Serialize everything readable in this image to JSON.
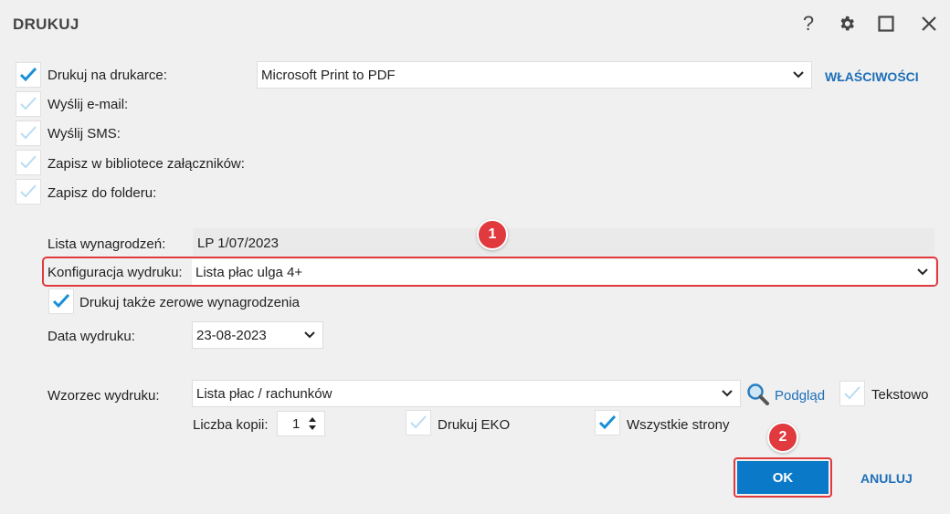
{
  "window": {
    "title": "DRUKUJ"
  },
  "options": {
    "print_printer": {
      "label": "Drukuj na drukarce:",
      "checked": true
    },
    "send_email": {
      "label": "Wyślij e-mail:",
      "checked": false
    },
    "send_sms": {
      "label": "Wyślij SMS:",
      "checked": false
    },
    "save_attachments": {
      "label": "Zapisz w bibliotece załączników:",
      "checked": false
    },
    "save_folder": {
      "label": "Zapisz do folderu:",
      "checked": false
    }
  },
  "printer": {
    "value": "Microsoft Print to PDF",
    "properties_label": "WŁAŚCIWOŚCI"
  },
  "payroll": {
    "label": "Lista wynagrodzeń:",
    "value": "LP 1/07/2023"
  },
  "config": {
    "label": "Konfiguracja wydruku:",
    "value": "Lista płac ulga 4+"
  },
  "zero_wages": {
    "label": "Drukuj także zerowe wynagrodzenia",
    "checked": true
  },
  "print_date": {
    "label": "Data wydruku:",
    "value": "23-08-2023"
  },
  "template": {
    "label": "Wzorzec wydruku:",
    "value": "Lista płac / rachunków",
    "preview_label": "Podgląd",
    "text_label": "Tekstowo"
  },
  "copies": {
    "label": "Liczba kopii:",
    "value": "1"
  },
  "eko": {
    "label": "Drukuj EKO",
    "checked": false
  },
  "all_pages": {
    "label": "Wszystkie strony",
    "checked": true
  },
  "buttons": {
    "ok": "OK",
    "cancel": "ANULUJ"
  },
  "badges": {
    "one": "1",
    "two": "2"
  },
  "colors": {
    "accent": "#0a7ac8",
    "link": "#1d6fb8",
    "highlight": "#e0393e",
    "check": "#1a8fd6",
    "check_light": "#b9dcf3"
  }
}
